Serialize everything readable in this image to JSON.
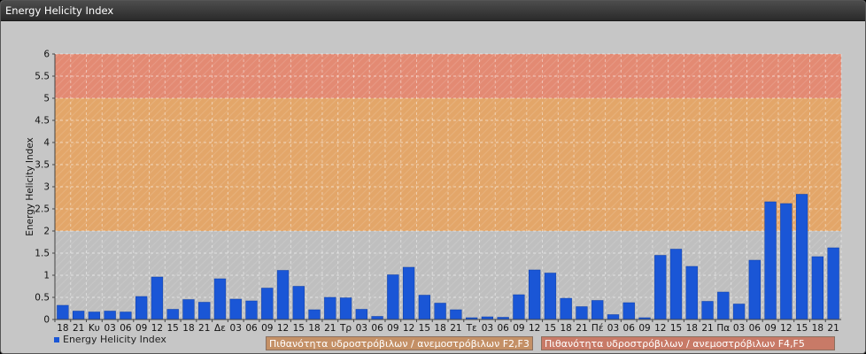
{
  "window": {
    "title": "Energy Helicity Index"
  },
  "colors": {
    "bar": "#1a56d6",
    "band_high": "#e38a73",
    "band_mid": "#e3a669",
    "band_low": "#bfbfbf",
    "band_legend_f2f3": "#c49066",
    "band_legend_f4f5": "#c87a67"
  },
  "legend": {
    "series_label": "Energy Helicity Index",
    "band_f2f3": "Πιθανότητα υδροστρόβιλων / ανεμοστρόβιλων F2,F3",
    "band_f4f5": "Πιθανότητα υδροστρόβιλων / ανεμοστρόβιλων F4,F5"
  },
  "chart_data": {
    "type": "bar",
    "ylabel": "Energy Helicity Index",
    "ylim": [
      0,
      6
    ],
    "yticks": [
      "0",
      "0.5",
      "1",
      "1.5",
      "2",
      "2.5",
      "3",
      "3.5",
      "4",
      "4.5",
      "5",
      "5.5",
      "6"
    ],
    "bands": [
      {
        "from": 0,
        "to": 2,
        "color": "#bfbfbf"
      },
      {
        "from": 2,
        "to": 5,
        "color": "#e3a669",
        "label": "Πιθανότητα υδροστρόβιλων / ανεμοστρόβιλων F2,F3"
      },
      {
        "from": 5,
        "to": 6,
        "color": "#e38a73",
        "label": "Πιθανότητα υδροστρόβιλων / ανεμοστρόβιλων F4,F5"
      }
    ],
    "grid": true,
    "categories": [
      "18",
      "21",
      "Κυ",
      "03",
      "06",
      "09",
      "12",
      "15",
      "18",
      "21",
      "Δε",
      "03",
      "06",
      "09",
      "12",
      "15",
      "18",
      "21",
      "Τρ",
      "03",
      "06",
      "09",
      "12",
      "15",
      "18",
      "21",
      "Τε",
      "03",
      "06",
      "09",
      "12",
      "15",
      "18",
      "21",
      "Πέ",
      "03",
      "06",
      "09",
      "12",
      "15",
      "18",
      "21",
      "Πα",
      "03",
      "06",
      "09",
      "12",
      "15",
      "18",
      "21"
    ],
    "values": [
      0.32,
      0.19,
      0.17,
      0.19,
      0.17,
      0.52,
      0.96,
      0.23,
      0.45,
      0.39,
      0.92,
      0.46,
      0.42,
      0.71,
      1.11,
      0.75,
      0.22,
      0.5,
      0.49,
      0.23,
      0.07,
      1.01,
      1.18,
      0.55,
      0.37,
      0.22,
      0.04,
      0.06,
      0.05,
      0.56,
      1.12,
      1.05,
      0.48,
      0.29,
      0.43,
      0.11,
      0.38,
      0.04,
      1.45,
      1.59,
      1.2,
      0.41,
      0.62,
      0.35,
      1.34,
      2.66,
      2.62,
      2.83,
      1.42,
      1.62
    ]
  }
}
